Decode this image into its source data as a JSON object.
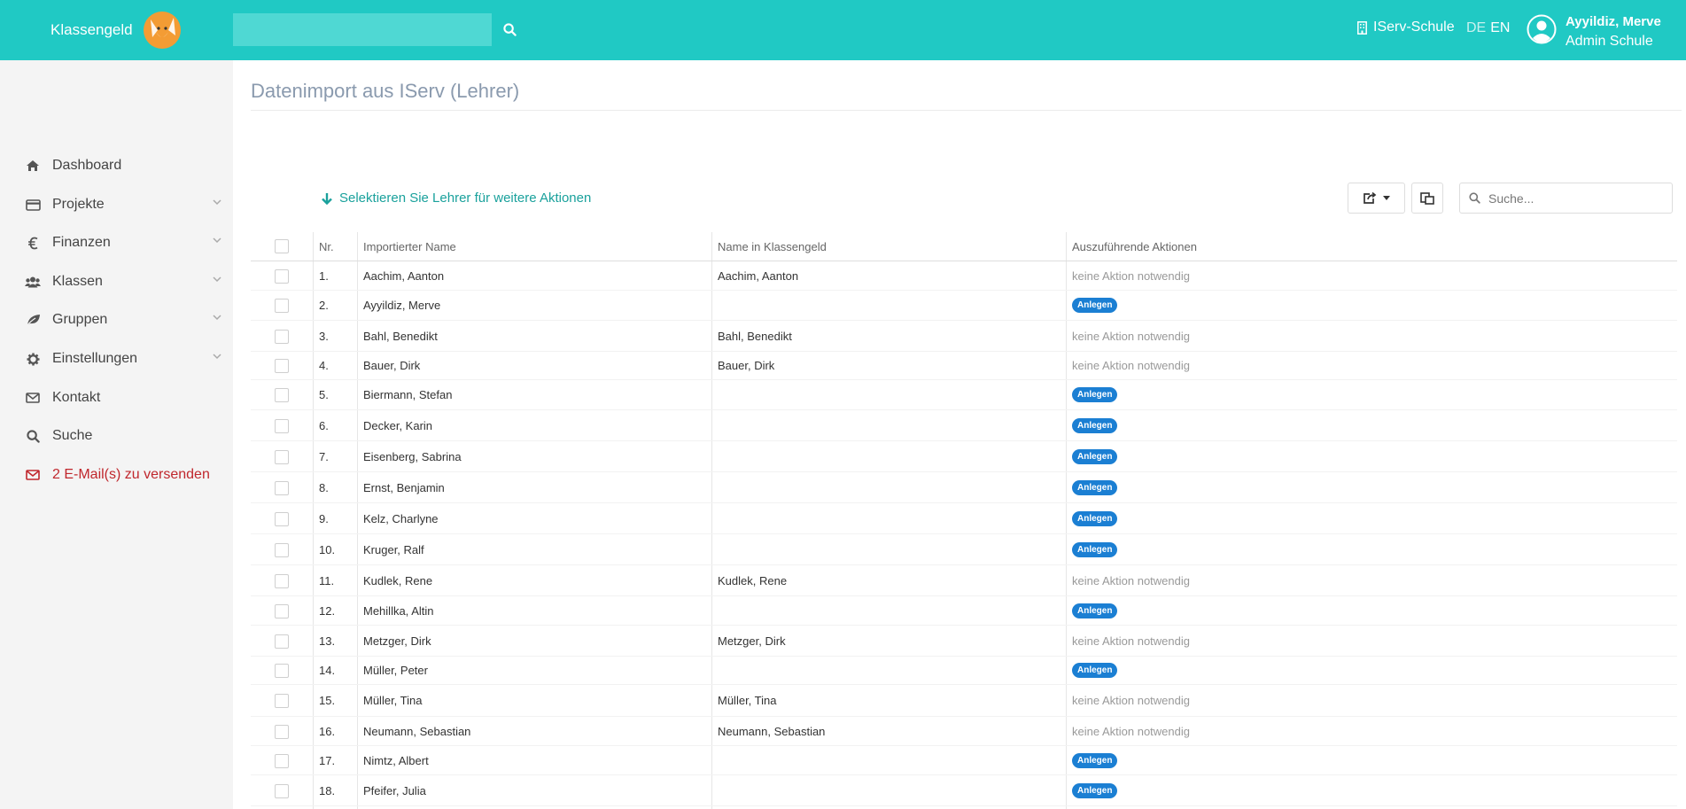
{
  "header": {
    "brand": "Klassengeld",
    "search_placeholder": "",
    "school": "IServ-Schule",
    "lang_de": "DE",
    "lang_en": "EN",
    "user_name": "Ayyildiz, Merve",
    "user_role": "Admin Schule",
    "accent_color": "#20c9c4"
  },
  "sidebar": {
    "items": [
      {
        "label": "Dashboard",
        "icon": "home-icon"
      },
      {
        "label": "Projekte",
        "icon": "credit-card-icon"
      },
      {
        "label": "Finanzen",
        "icon": "euro-icon"
      },
      {
        "label": "Klassen",
        "icon": "users-icon"
      },
      {
        "label": "Gruppen",
        "icon": "leaf-icon"
      },
      {
        "label": "Einstellungen",
        "icon": "gear-icon"
      },
      {
        "label": "Kontakt",
        "icon": "envelope-icon"
      },
      {
        "label": "Suche",
        "icon": "search-icon"
      },
      {
        "label": "2 E-Mail(s) zu versenden",
        "icon": "envelope-icon"
      }
    ]
  },
  "main": {
    "title": "Datenimport aus IServ (Lehrer)",
    "select_hint": "Selektieren Sie Lehrer für weitere Aktionen",
    "search_placeholder": "Suche...",
    "columns": [
      "Nr.",
      "Importierter Name",
      "Name in Klassengeld",
      "Auszuführende Aktionen"
    ],
    "action_none": "keine Aktion notwendig",
    "action_create": "Anlegen",
    "rows": [
      {
        "nr": "1.",
        "imported": "Aachim, Aanton",
        "existing": "Aachim, Aanton",
        "action": "keine Aktion notwendig"
      },
      {
        "nr": "2.",
        "imported": "Ayyildiz, Merve",
        "existing": "",
        "action": "Anlegen"
      },
      {
        "nr": "3.",
        "imported": "Bahl, Benedikt",
        "existing": "Bahl, Benedikt",
        "action": "keine Aktion notwendig"
      },
      {
        "nr": "4.",
        "imported": "Bauer, Dirk",
        "existing": "Bauer, Dirk",
        "action": "keine Aktion notwendig"
      },
      {
        "nr": "5.",
        "imported": "Biermann, Stefan",
        "existing": "",
        "action": "Anlegen"
      },
      {
        "nr": "6.",
        "imported": "Decker, Karin",
        "existing": "",
        "action": "Anlegen"
      },
      {
        "nr": "7.",
        "imported": "Eisenberg, Sabrina",
        "existing": "",
        "action": "Anlegen"
      },
      {
        "nr": "8.",
        "imported": "Ernst, Benjamin",
        "existing": "",
        "action": "Anlegen"
      },
      {
        "nr": "9.",
        "imported": "Kelz, Charlyne",
        "existing": "",
        "action": "Anlegen"
      },
      {
        "nr": "10.",
        "imported": "Kruger, Ralf",
        "existing": "",
        "action": "Anlegen"
      },
      {
        "nr": "11.",
        "imported": "Kudlek, Rene",
        "existing": "Kudlek, Rene",
        "action": "keine Aktion notwendig"
      },
      {
        "nr": "12.",
        "imported": "Mehillka, Altin",
        "existing": "",
        "action": "Anlegen"
      },
      {
        "nr": "13.",
        "imported": "Metzger, Dirk",
        "existing": "Metzger, Dirk",
        "action": "keine Aktion notwendig"
      },
      {
        "nr": "14.",
        "imported": "Müller, Peter",
        "existing": "",
        "action": "Anlegen"
      },
      {
        "nr": "15.",
        "imported": "Müller, Tina",
        "existing": "Müller, Tina",
        "action": "keine Aktion notwendig"
      },
      {
        "nr": "16.",
        "imported": "Neumann, Sebastian",
        "existing": "Neumann, Sebastian",
        "action": "keine Aktion notwendig"
      },
      {
        "nr": "17.",
        "imported": "Nimtz, Albert",
        "existing": "",
        "action": "Anlegen"
      },
      {
        "nr": "18.",
        "imported": "Pfeifer, Julia",
        "existing": "",
        "action": "Anlegen"
      }
    ]
  }
}
